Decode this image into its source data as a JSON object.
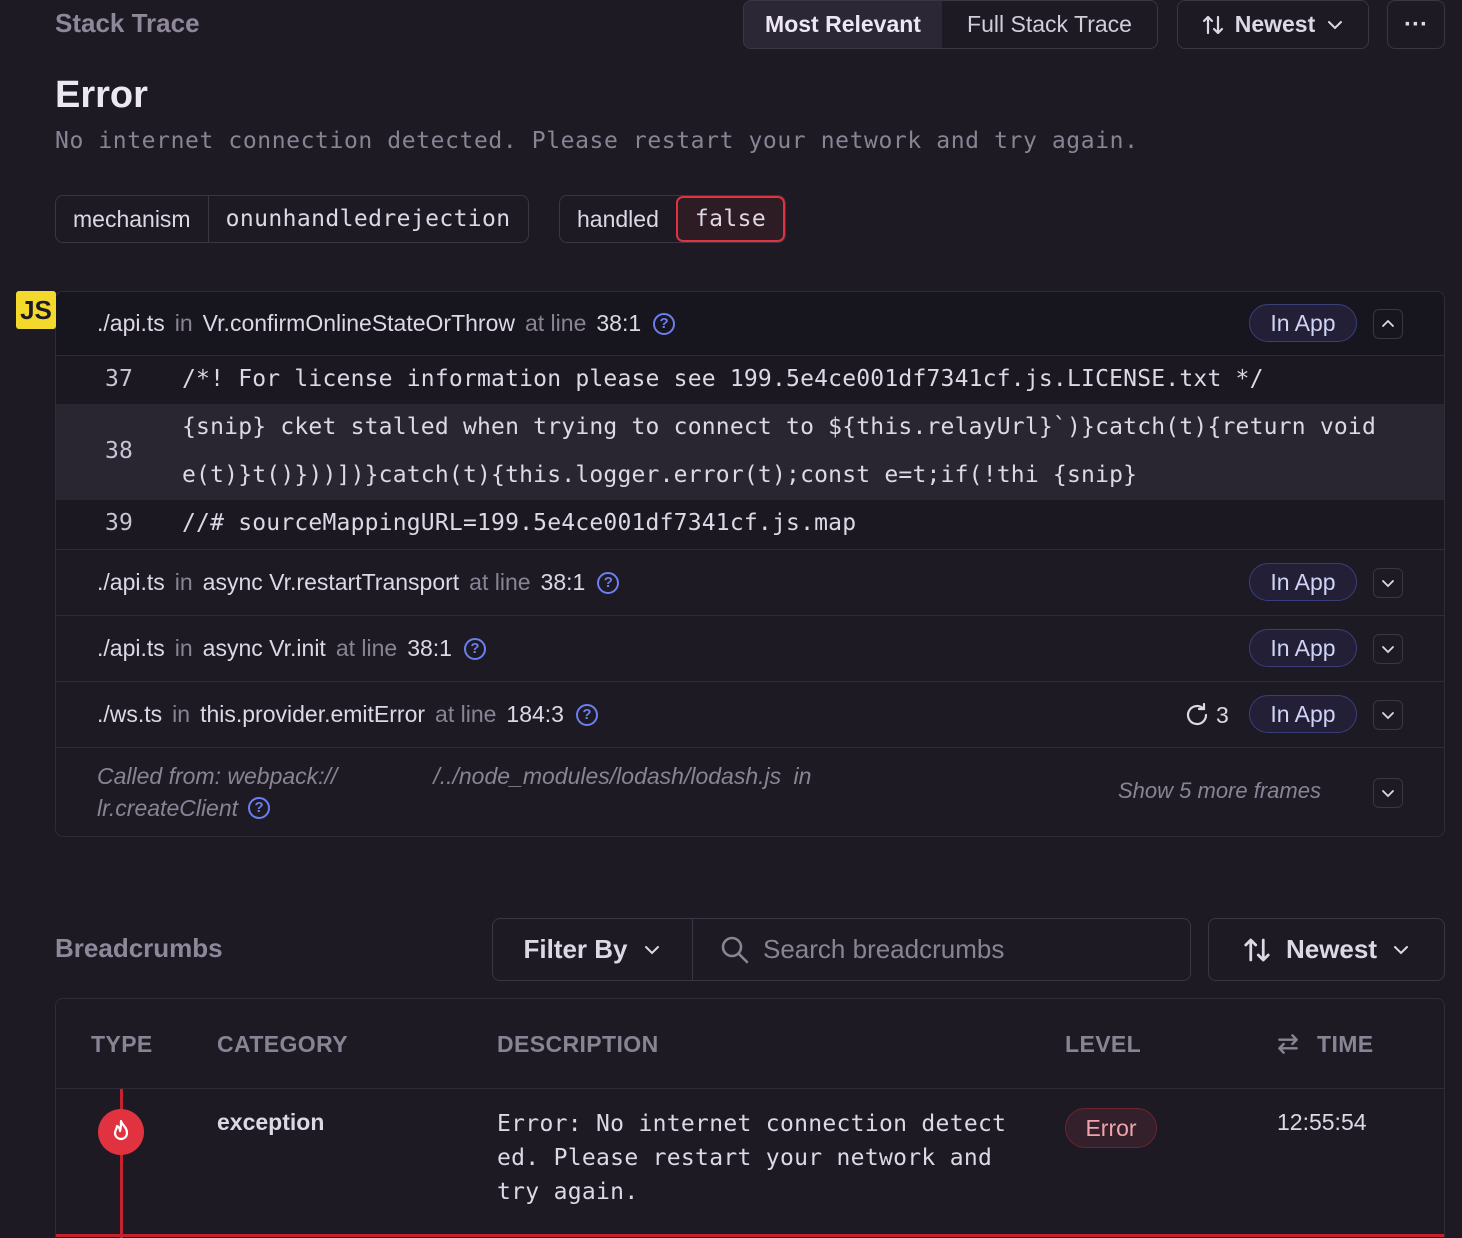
{
  "stack_trace": {
    "title": "Stack Trace",
    "view_tabs": [
      "Most Relevant",
      "Full Stack Trace"
    ],
    "sort_label": "Newest",
    "more_label": "···"
  },
  "error": {
    "title": "Error",
    "message": "No internet connection detected. Please restart your network and try again."
  },
  "tags": [
    {
      "key": "mechanism",
      "value": "onunhandledrejection"
    },
    {
      "key": "handled",
      "value": "false"
    }
  ],
  "platform_badge": "JS",
  "frames": [
    {
      "file": "./api.ts",
      "in": "in",
      "fn": "Vr.confirmOnlineStateOrThrow",
      "at": "at line",
      "line": "38:1",
      "badge": "In App",
      "expanded": true
    },
    {
      "file": "./api.ts",
      "in": "in",
      "fn": "async Vr.restartTransport",
      "at": "at line",
      "line": "38:1",
      "badge": "In App"
    },
    {
      "file": "./api.ts",
      "in": "in",
      "fn": "async Vr.init",
      "at": "at line",
      "line": "38:1",
      "badge": "In App"
    },
    {
      "file": "./ws.ts",
      "in": "in",
      "fn": "this.provider.emitError",
      "at": "at line",
      "line": "184:3",
      "badge": "In App",
      "repeats": "3"
    }
  ],
  "code": [
    {
      "ln": "37",
      "src": "/*! For license information please see 199.5e4ce001df7341cf.js.LICENSE.txt */"
    },
    {
      "ln": "38",
      "src1": "{snip} cket stalled when trying to connect to ${this.relayUrl}`)}catch(t){return void",
      "src2": "e(t)}t()}))])}catch(t){this.logger.error(t);const e=t;if(!thi {snip}"
    },
    {
      "ln": "39",
      "src": "//# sourceMappingURL=199.5e4ce001df7341cf.js.map"
    }
  ],
  "called_from": {
    "prefix": "Called from: webpack://",
    "path": "/../node_modules/lodash/lodash.js",
    "in": "in",
    "fn": "lr.createClient",
    "show_more": "Show 5 more frames"
  },
  "breadcrumbs": {
    "title": "Breadcrumbs",
    "filter_label": "Filter By",
    "search_placeholder": "Search breadcrumbs",
    "sort_label": "Newest",
    "columns": [
      "TYPE",
      "CATEGORY",
      "DESCRIPTION",
      "LEVEL",
      "TIME"
    ],
    "rows": [
      {
        "type_icon": "fire-icon",
        "category": "exception",
        "description": "Error: No internet connection detected. Please restart your network and try again.",
        "level": "Error",
        "time": "12:55:54"
      }
    ]
  },
  "colors": {
    "background": "#1d1a24",
    "error_red": "#e0333f",
    "in_app_accent": "#6b7ff0",
    "js_badge": "#f3d92b"
  }
}
